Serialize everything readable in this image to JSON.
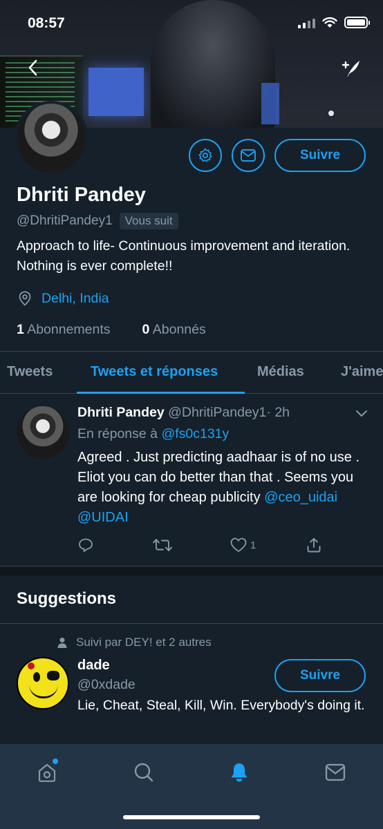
{
  "status_bar": {
    "time": "08:57"
  },
  "header": {
    "back_label": "‹",
    "compose_icon": "compose-feather-icon"
  },
  "profile": {
    "name": "Dhriti Pandey",
    "handle": "@DhritiPandey1",
    "follows_you": "Vous suit",
    "bio": "Approach to life- Continuous improvement and iteration. Nothing is ever complete!!",
    "location": "Delhi, India",
    "following_count": "1",
    "following_label": "Abonnements",
    "followers_count": "0",
    "followers_label": "Abonnés",
    "follow_label": "Suivre"
  },
  "tabs": [
    {
      "label": "Tweets"
    },
    {
      "label": "Tweets et réponses"
    },
    {
      "label": "Médias"
    },
    {
      "label": "J'aime"
    }
  ],
  "tweet": {
    "author_name": "Dhriti Pandey",
    "author_handle": "@DhritiPandey1",
    "time": "· 2h",
    "reply_prefix": "En réponse à",
    "reply_to": "@fs0c131y",
    "text": "Agreed . Just predicting aadhaar is of no use . Eliot you can do better than that . Seems you are looking for cheap publicity",
    "mention_1": "@ceo_uidai",
    "mention_2": "@UIDAI",
    "like_count": "1"
  },
  "suggestions": {
    "title": "Suggestions",
    "context": "Suivi par DEY! et 2 autres",
    "user_name": "dade",
    "user_handle": "@0xdade",
    "user_bio": "Lie, Cheat, Steal, Kill, Win. Everybody's doing it.",
    "follow_label": "Suivre"
  },
  "colors": {
    "background": "#15202b",
    "accent": "#1da1f2",
    "secondary_text": "#8899a6",
    "nav_background": "#243447"
  }
}
